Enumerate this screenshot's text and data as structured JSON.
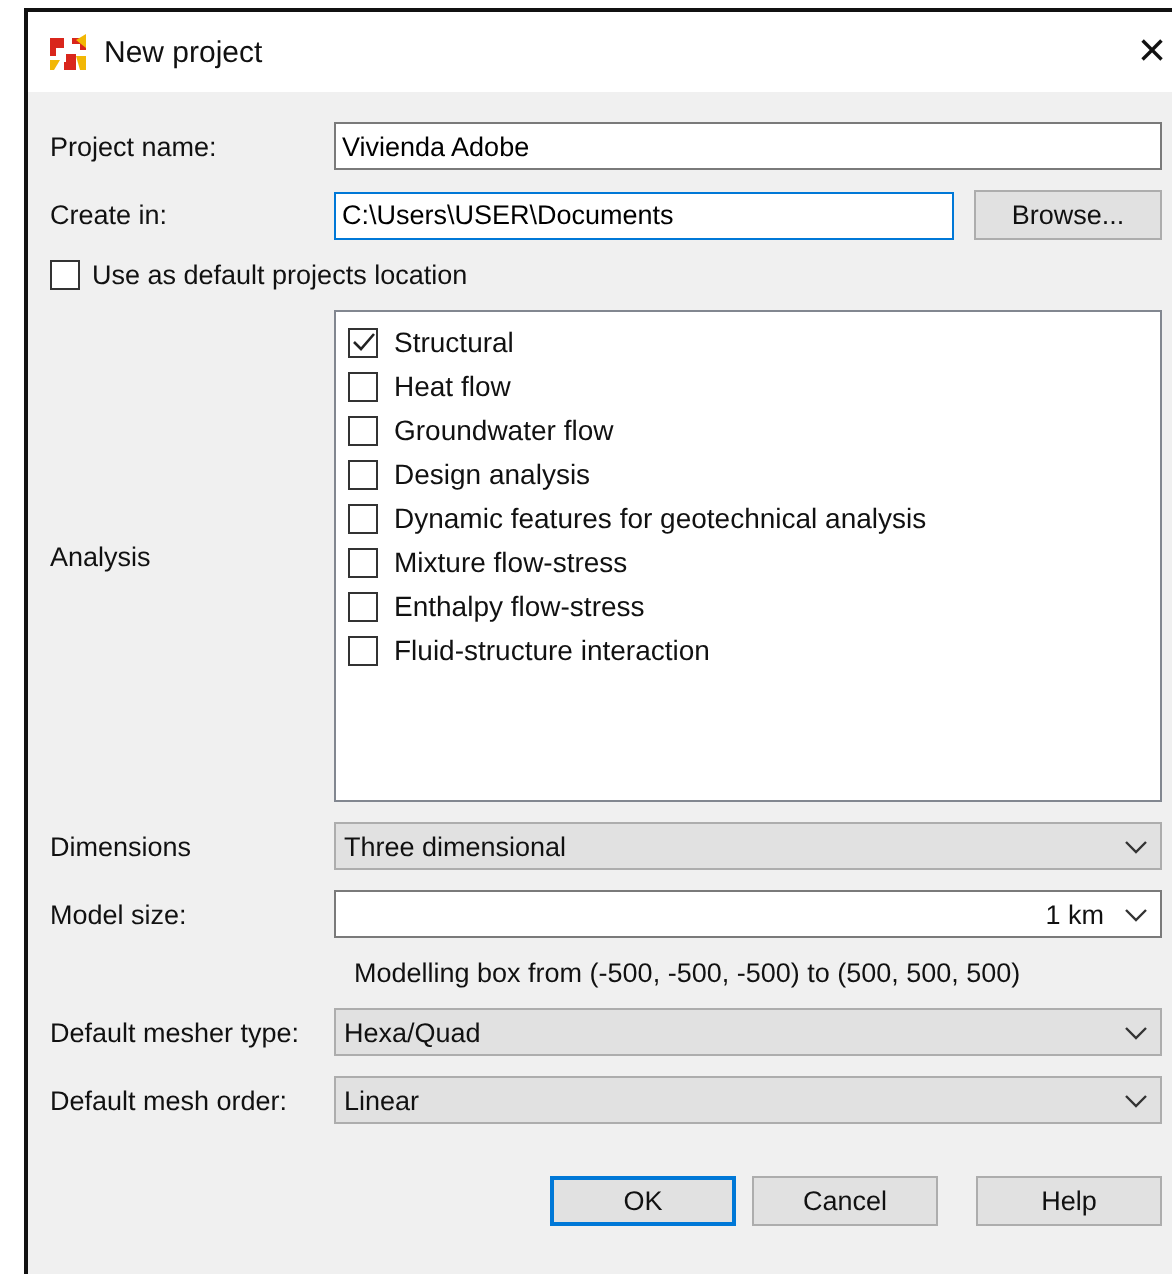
{
  "window": {
    "title": "New project",
    "close": "×"
  },
  "project_name": {
    "label": "Project name:",
    "value": "Vivienda Adobe",
    "focused": false
  },
  "create_in": {
    "label": "Create in:",
    "value": "C:\\Users\\USER\\Documents",
    "focused": true,
    "button": "Browse..."
  },
  "default_location": {
    "label": "Use as default projects location",
    "checked": false
  },
  "analysis": {
    "label": "Analysis",
    "items": [
      {
        "label": "Structural",
        "checked": true
      },
      {
        "label": "Heat flow",
        "checked": false
      },
      {
        "label": "Groundwater flow",
        "checked": false
      },
      {
        "label": "Design analysis",
        "checked": false
      },
      {
        "label": "Dynamic features for geotechnical analysis",
        "checked": false
      },
      {
        "label": "Mixture flow-stress",
        "checked": false
      },
      {
        "label": "Enthalpy flow-stress",
        "checked": false
      },
      {
        "label": "Fluid-structure interaction",
        "checked": false
      }
    ]
  },
  "dimensions": {
    "label": "Dimensions",
    "value": "Three dimensional"
  },
  "model_size": {
    "label": "Model size:",
    "value": "1 km",
    "note": "Modelling box from (-500, -500, -500) to (500, 500, 500)"
  },
  "mesher_type": {
    "label": "Default mesher type:",
    "value": "Hexa/Quad"
  },
  "mesh_order": {
    "label": "Default mesh order:",
    "value": "Linear"
  },
  "buttons": [
    {
      "label": "OK",
      "default": true
    },
    {
      "label": "Cancel",
      "default": false
    },
    {
      "label": "Help",
      "default": false
    }
  ]
}
